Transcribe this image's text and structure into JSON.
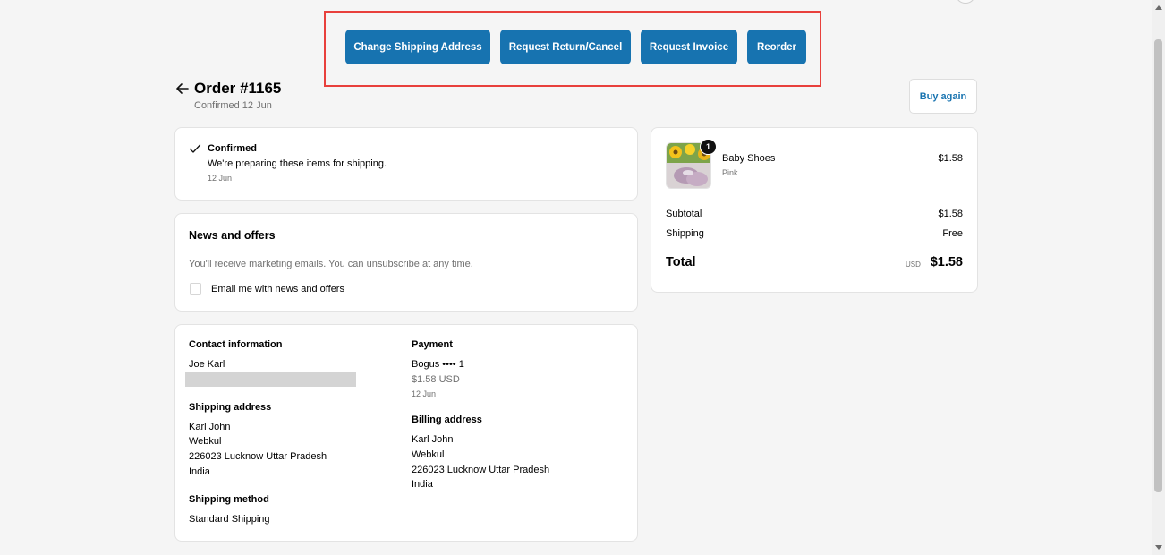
{
  "actions": {
    "change_shipping": "Change Shipping Address",
    "return_cancel": "Request Return/Cancel",
    "invoice": "Request Invoice",
    "reorder": "Reorder"
  },
  "header": {
    "title": "Order #1165",
    "subtitle": "Confirmed 12 Jun",
    "buy_again": "Buy again"
  },
  "status": {
    "title": "Confirmed",
    "message": "We're preparing these items for shipping.",
    "date": "12 Jun"
  },
  "news": {
    "title": "News and offers",
    "description": "You'll receive marketing emails. You can unsubscribe at any time.",
    "checkbox_label": "Email me with news and offers",
    "checked": false
  },
  "contact": {
    "heading": "Contact information",
    "name": "Joe Karl"
  },
  "payment": {
    "heading": "Payment",
    "method": "Bogus •••• 1",
    "amount": "$1.58 USD",
    "date": "12 Jun"
  },
  "shipping_address": {
    "heading": "Shipping address",
    "lines": [
      "Karl John",
      "Webkul",
      "226023 Lucknow Uttar Pradesh",
      "India"
    ]
  },
  "billing_address": {
    "heading": "Billing address",
    "lines": [
      "Karl John",
      "Webkul",
      "226023 Lucknow Uttar Pradesh",
      "India"
    ]
  },
  "shipping_method": {
    "heading": "Shipping method",
    "value": "Standard Shipping"
  },
  "summary": {
    "item": {
      "name": "Baby Shoes",
      "variant": "Pink",
      "price": "$1.58",
      "quantity": "1"
    },
    "subtotal_label": "Subtotal",
    "subtotal": "$1.58",
    "shipping_label": "Shipping",
    "shipping": "Free",
    "total_label": "Total",
    "currency": "USD",
    "total": "$1.58"
  },
  "colors": {
    "primary": "#1773b0",
    "highlight_border": "#e8403c"
  }
}
